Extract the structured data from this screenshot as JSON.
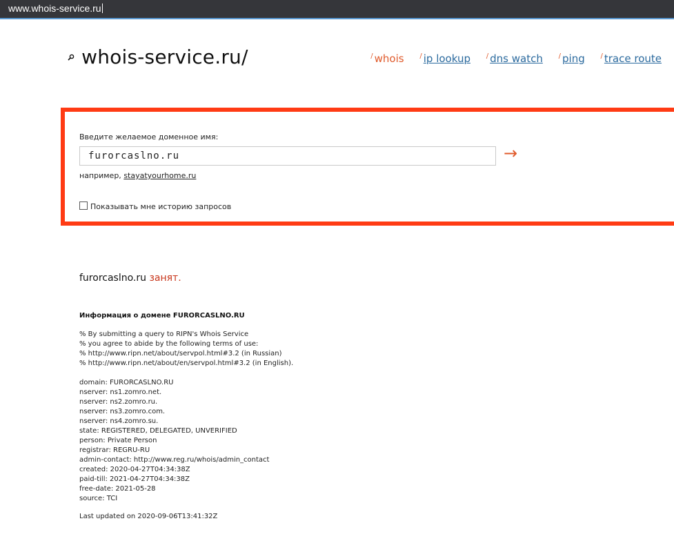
{
  "browser": {
    "url": "www.whois-service.ru"
  },
  "header": {
    "logo": "whois-service.ru/",
    "nav": [
      {
        "label": "whois",
        "active": true
      },
      {
        "label": "ip lookup",
        "active": false
      },
      {
        "label": "dns watch",
        "active": false
      },
      {
        "label": "ping",
        "active": false
      },
      {
        "label": "trace route",
        "active": false
      }
    ]
  },
  "search": {
    "label": "Введите желаемое доменное имя:",
    "value": "furorcaslno.ru",
    "submit_glyph": "→",
    "example_prefix": "например, ",
    "example_link": "stayatyourhome.ru",
    "history_label": "Показывать мне историю запросов",
    "history_checked": false
  },
  "result": {
    "domain": "furorcaslno.ru",
    "status": "занят."
  },
  "info": {
    "title": "Информация о домене FURORCASLNO.RU",
    "terms": [
      "% By submitting a query to RIPN's Whois Service",
      "% you agree to abide by the following terms of use:",
      "% http://www.ripn.net/about/servpol.html#3.2 (in Russian)",
      "% http://www.ripn.net/about/en/servpol.html#3.2 (in English)."
    ],
    "records": [
      "domain: FURORCASLNO.RU",
      "nserver: ns1.zomro.net.",
      "nserver: ns2.zomro.ru.",
      "nserver: ns3.zomro.com.",
      "nserver: ns4.zomro.su.",
      "state: REGISTERED, DELEGATED, UNVERIFIED",
      "person: Private Person",
      "registrar: REGRU-RU",
      "admin-contact: http://www.reg.ru/whois/admin_contact",
      "created: 2020-04-27T04:34:38Z",
      "paid-till: 2021-04-27T04:34:38Z",
      "free-date: 2021-05-28",
      "source: TCI"
    ],
    "updated": "Last updated on 2020-09-06T13:41:32Z"
  },
  "colors": {
    "accent": "#e05a2b",
    "frame": "#ff3b14",
    "link": "#2b6a9e"
  }
}
